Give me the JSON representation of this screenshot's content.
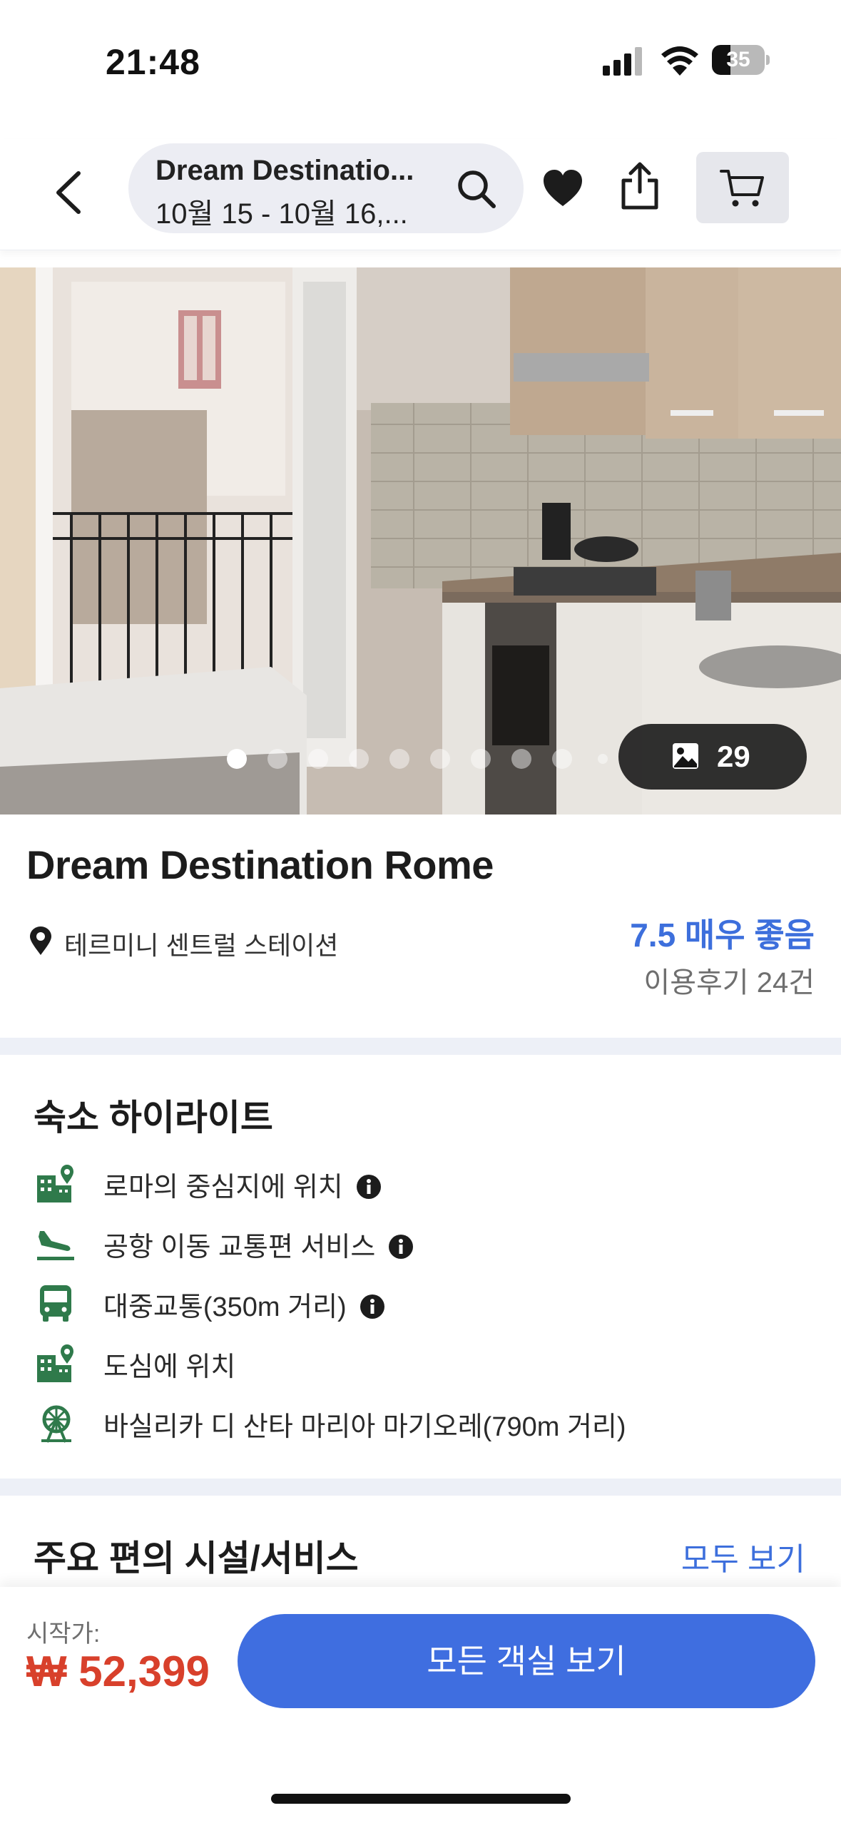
{
  "status_bar": {
    "time": "21:48",
    "battery_level": "35"
  },
  "nav": {
    "search_title": "Dream Destinatio...",
    "search_dates": "10월 15 - 10월 16,...",
    "icons": [
      "back-arrow-icon",
      "search-icon",
      "heart-icon",
      "share-icon",
      "cart-icon"
    ]
  },
  "gallery": {
    "photo_count": "29",
    "active_dot": 1,
    "dot_count": 10
  },
  "property": {
    "name": "Dream Destination Rome",
    "location": "테르미니 센트럴 스테이션",
    "rating": "7.5 매우 좋음",
    "reviews": "이용후기 24건"
  },
  "highlights": {
    "title": "숙소 하이라이트",
    "items": [
      {
        "label": "로마의 중심지에 위치",
        "icon": "city-pin-icon",
        "info": true
      },
      {
        "label": "공항 이동 교통편 서비스",
        "icon": "plane-landing-icon",
        "info": true
      },
      {
        "label": "대중교통(350m 거리)",
        "icon": "bus-icon",
        "info": true
      },
      {
        "label": "도심에 위치",
        "icon": "city-pin-icon",
        "info": false
      },
      {
        "label": "바실리카 디 산타 마리아 마기오레(790m 거리)",
        "icon": "ferris-wheel-icon",
        "info": false
      }
    ]
  },
  "amenities": {
    "title": "주요 편의 시설/서비스",
    "see_all": "모두 보기"
  },
  "booking": {
    "price_label": "시작가:",
    "price": "₩ 52,399",
    "button_label": "모든 객실 보기"
  },
  "colors": {
    "accent_blue": "#3f6ee0",
    "rating_blue": "#3d6fdc",
    "price_red": "#d8402b",
    "icon_green": "#2f7a4b",
    "band_gray": "#edf0f7"
  }
}
